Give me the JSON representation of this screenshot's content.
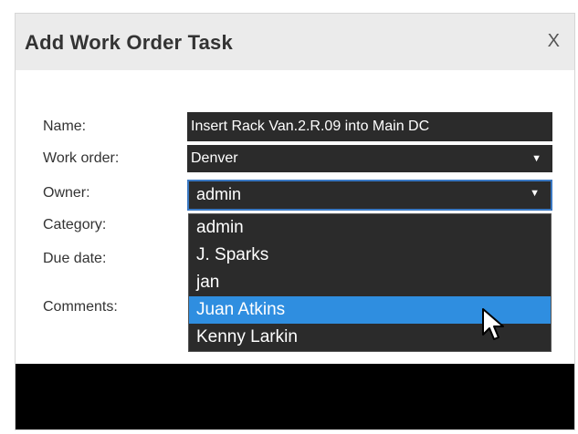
{
  "dialog": {
    "title": "Add Work Order Task",
    "close_label": "X"
  },
  "form": {
    "name_label": "Name:",
    "name_value": "Insert Rack Van.2.R.09 into Main DC",
    "work_order_label": "Work order:",
    "work_order_value": "Denver",
    "owner_label": "Owner:",
    "owner_value": "admin",
    "category_label": "Category:",
    "due_date_label": "Due date:",
    "comments_label": "Comments:",
    "select_arrow": "▼"
  },
  "owner_dropdown": {
    "options": [
      "admin",
      "J. Sparks",
      "jan",
      "Juan Atkins",
      "Kenny Larkin"
    ],
    "highlighted": "Juan Atkins"
  },
  "colors": {
    "titlebar": "#ebebeb",
    "field_bg": "#2b2b2b",
    "highlight": "#2f8ee0",
    "focus_border": "#3a78c2"
  },
  "icons": {
    "close": "close-icon",
    "dropdown_arrow": "chevron-down-icon",
    "cursor": "mouse-pointer-icon"
  }
}
